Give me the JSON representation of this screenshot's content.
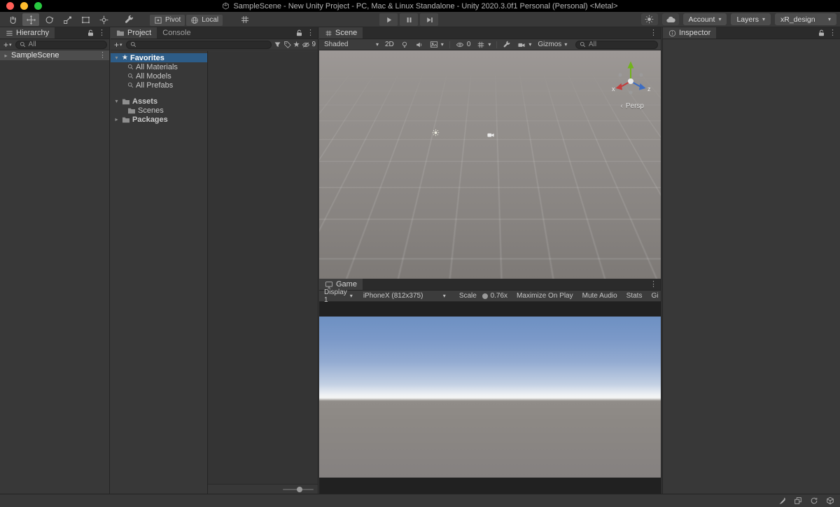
{
  "window": {
    "title": "SampleScene - New Unity Project - PC, Mac & Linux Standalone - Unity 2020.3.0f1 Personal (Personal) <Metal>"
  },
  "colors": {
    "selection_blue": "#2d5c87",
    "selected_row_gray": "#4d4d4d",
    "traffic_red": "#ff5f57",
    "traffic_yellow": "#febc2e",
    "traffic_green": "#28c840",
    "panel_bg": "#383838",
    "tabbar_bg": "#2b2b2b"
  },
  "icons": {
    "chevron_down": "▾",
    "kebab": "⋮",
    "collapsed": "▸",
    "expanded": "▾",
    "star": "★",
    "plus": "+",
    "persp_chevron": "‹"
  },
  "toolbar": {
    "pivot": "Pivot",
    "local": "Local",
    "account": "Account",
    "layers": "Layers",
    "layout": "xR_design"
  },
  "hierarchy": {
    "title": "Hierarchy",
    "search_text": "All",
    "scene_item": "SampleScene"
  },
  "project": {
    "tab_project": "Project",
    "tab_console": "Console",
    "hidden_count": "9",
    "favorites_label": "Favorites",
    "favorites_children": [
      "All Materials",
      "All Models",
      "All Prefabs"
    ],
    "assets_label": "Assets",
    "assets_children": [
      "Scenes"
    ],
    "packages_label": "Packages"
  },
  "scene": {
    "tab": "Scene",
    "shading": "Shaded",
    "mode_2d": "2D",
    "visibility_count": "0",
    "gizmos": "Gizmos",
    "search_text": "All",
    "persp": "Persp",
    "axis_x": "x",
    "axis_z": "z"
  },
  "game": {
    "tab": "Game",
    "display": "Display 1",
    "aspect": "iPhoneX (812x375)",
    "scale_label": "Scale",
    "scale_value": "0.76x",
    "maximize": "Maximize On Play",
    "mute": "Mute Audio",
    "stats": "Stats",
    "gizmos": "Gizmos"
  },
  "inspector": {
    "title": "Inspector"
  }
}
